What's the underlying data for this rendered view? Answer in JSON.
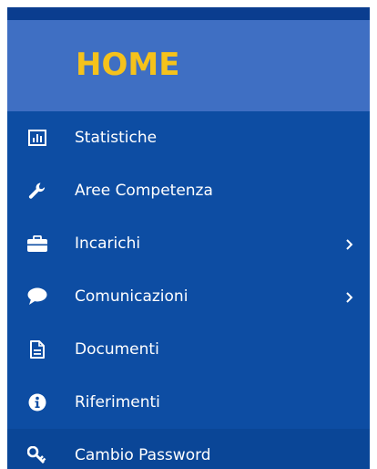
{
  "header": {
    "title": "HOME"
  },
  "menu": {
    "items": [
      {
        "label": "Statistiche",
        "icon": "bar-chart-icon"
      },
      {
        "label": "Aree Competenza",
        "icon": "wrench-icon"
      },
      {
        "label": "Incarichi",
        "icon": "briefcase-icon",
        "has_submenu": true
      },
      {
        "label": "Comunicazioni",
        "icon": "comment-icon",
        "has_submenu": true
      },
      {
        "label": "Documenti",
        "icon": "document-icon"
      },
      {
        "label": "Riferimenti",
        "icon": "info-icon"
      },
      {
        "label": "Cambio Password",
        "icon": "key-icon"
      }
    ]
  },
  "colors": {
    "sidebar_bg": "#0d4da3",
    "header_bg": "#3f6fc3",
    "title_color": "#f5c21b",
    "text_color": "#ffffff"
  }
}
